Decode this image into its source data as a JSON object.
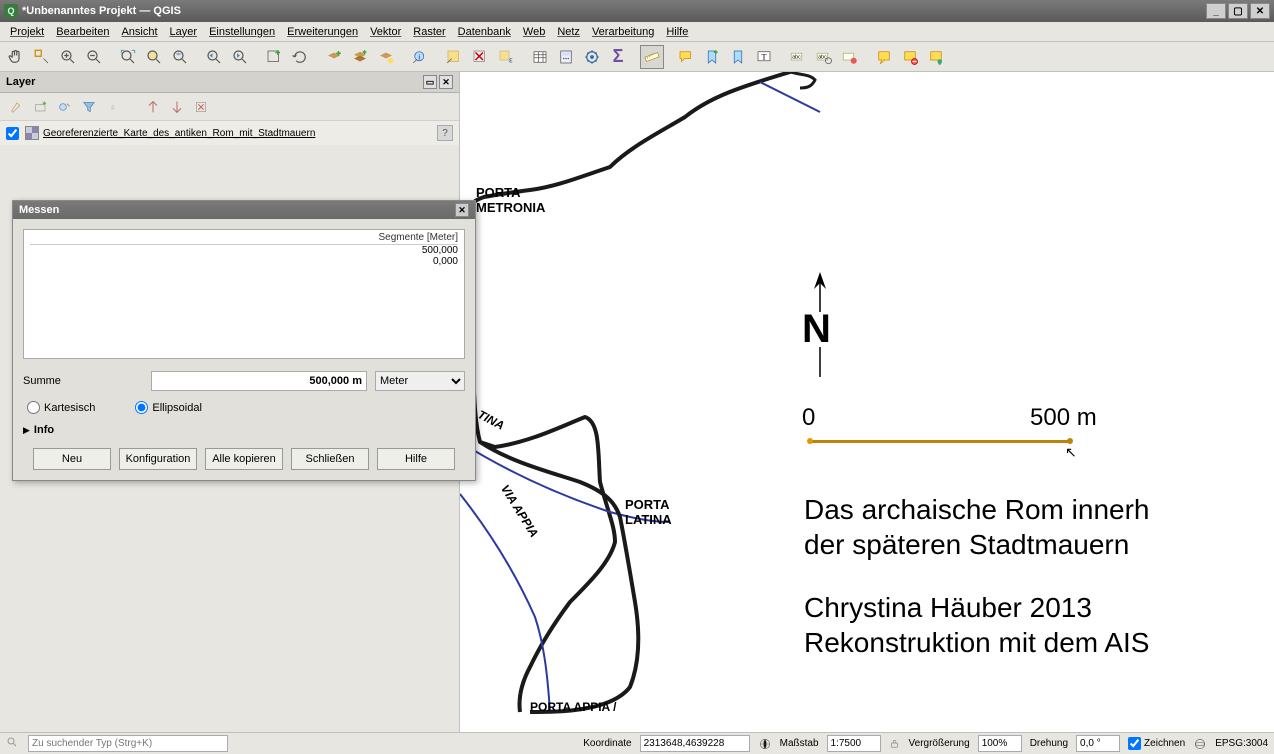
{
  "title": "*Unbenanntes Projekt — QGIS",
  "menu": [
    "Projekt",
    "Bearbeiten",
    "Ansicht",
    "Layer",
    "Einstellungen",
    "Erweiterungen",
    "Vektor",
    "Raster",
    "Datenbank",
    "Web",
    "Netz",
    "Verarbeitung",
    "Hilfe"
  ],
  "layers_panel": {
    "title": "Layer",
    "item": "Georeferenzierte_Karte_des_antiken_Rom_mit_Stadtmauern"
  },
  "measure": {
    "title": "Messen",
    "segments_header": "Segmente [Meter]",
    "seg1": "500,000",
    "seg2": "0,000",
    "sum_label": "Summe",
    "sum_value": "500,000 m",
    "unit": "Meter",
    "cartesian": "Kartesisch",
    "ellipsoidal": "Ellipsoidal",
    "info": "Info",
    "btn_new": "Neu",
    "btn_config": "Konfiguration",
    "btn_copy": "Alle kopieren",
    "btn_close": "Schließen",
    "btn_help": "Hilfe"
  },
  "map": {
    "porta_metronia1": "PORTA",
    "porta_metronia2": "METRONIA",
    "via_latina": "TINA",
    "via_appia": "VIA APPIA",
    "porta_latina1": "PORTA",
    "porta_latina2": "LATINA",
    "porta_appia1": "PORTA APPIA /",
    "north": "N",
    "scale0": "0",
    "scale500": "500 m",
    "legend1": "Das archaische Rom innerh",
    "legend2": "der späteren Stadtmauern",
    "legend3": "Chrystina Häuber 2013",
    "legend4": "Rekonstruktion mit dem AIS"
  },
  "status": {
    "search_placeholder": "Zu suchender Typ (Strg+K)",
    "coord_label": "Koordinate",
    "coord_value": "2313648,4639228",
    "scale_label": "Maßstab",
    "scale_value": "1:7500",
    "mag_label": "Vergrößerung",
    "mag_value": "100%",
    "rot_label": "Drehung",
    "rot_value": "0,0 °",
    "render": "Zeichnen",
    "crs": "EPSG:3004"
  }
}
